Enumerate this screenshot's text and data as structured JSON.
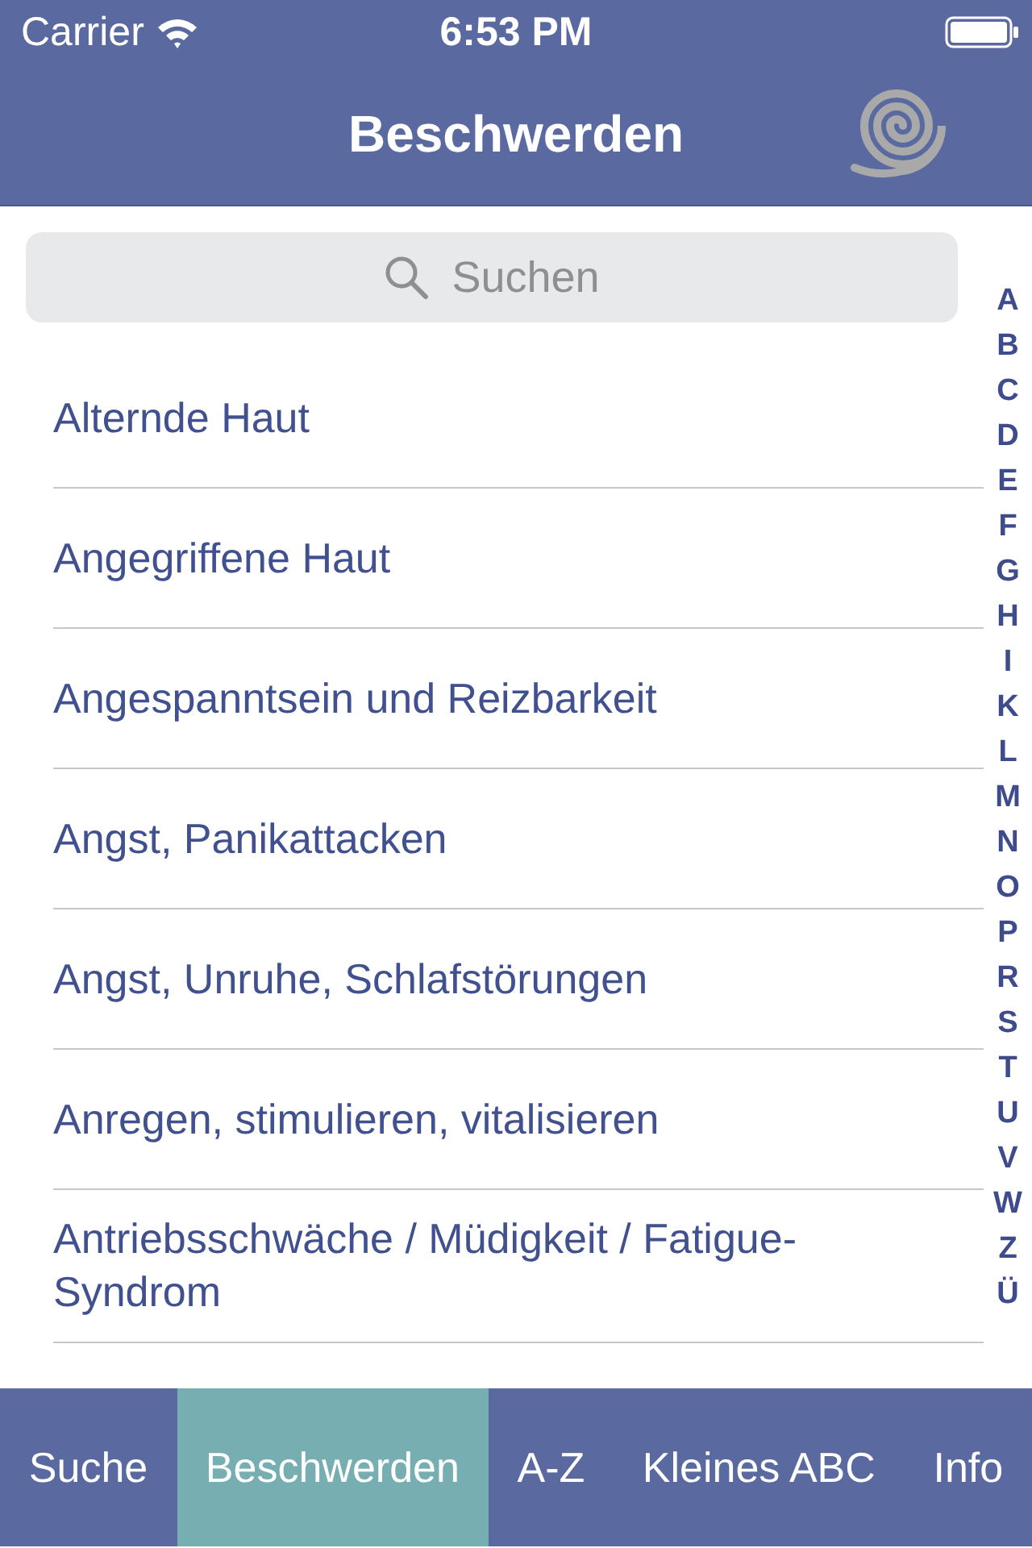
{
  "status_bar": {
    "carrier": "Carrier",
    "time": "6:53 PM"
  },
  "nav_bar": {
    "title": "Beschwerden"
  },
  "search": {
    "placeholder": "Suchen"
  },
  "list": {
    "items": [
      {
        "label": "Alternde Haut"
      },
      {
        "label": "Angegriffene Haut"
      },
      {
        "label": "Angespanntsein und Reizbarkeit"
      },
      {
        "label": "Angst, Panikattacken"
      },
      {
        "label": "Angst, Unruhe, Schlafstörungen"
      },
      {
        "label": "Anregen, stimulieren, vitalisieren"
      },
      {
        "label": "Antriebsschwäche / Müdigkeit / Fatigue-Syndrom"
      }
    ]
  },
  "section_index": [
    "A",
    "B",
    "C",
    "D",
    "E",
    "F",
    "G",
    "H",
    "I",
    "K",
    "L",
    "M",
    "N",
    "O",
    "P",
    "R",
    "S",
    "T",
    "U",
    "V",
    "W",
    "Z",
    "Ü"
  ],
  "tab_bar": {
    "tabs": [
      {
        "label": "Suche",
        "selected": false
      },
      {
        "label": "Beschwerden",
        "selected": true
      },
      {
        "label": "A-Z",
        "selected": false
      },
      {
        "label": "Kleines ABC",
        "selected": false
      },
      {
        "label": "Info",
        "selected": false
      }
    ]
  }
}
